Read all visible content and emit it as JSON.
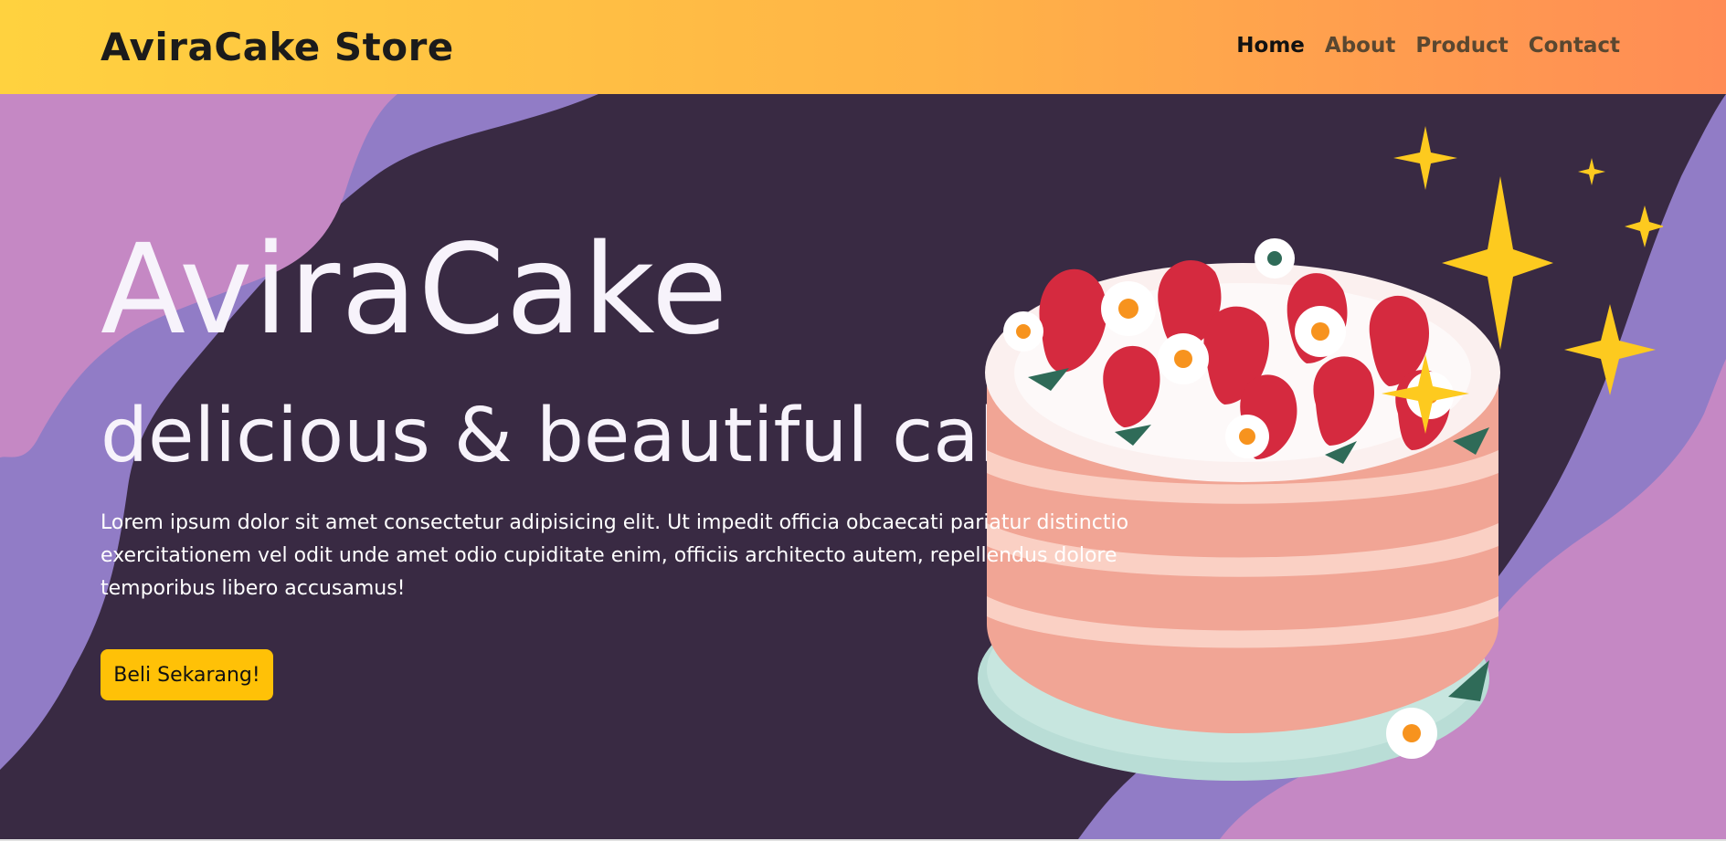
{
  "navbar": {
    "brand": "AviraCake Store",
    "links": [
      {
        "label": "Home",
        "active": true
      },
      {
        "label": "About",
        "active": false
      },
      {
        "label": "Product",
        "active": false
      },
      {
        "label": "Contact",
        "active": false
      }
    ]
  },
  "hero": {
    "title": "AviraCake",
    "subtitle": "delicious & beautiful cakes",
    "description": "Lorem ipsum dolor sit amet consectetur adipisicing elit. Ut impedit officia obcaecati pariatur distinctio exercitationem vel odit unde amet odio cupiditate enim, officiis architecto autem, repellendus dolore temporibus libero accusamus!",
    "cta_label": "Beli Sekarang!"
  },
  "colors": {
    "navbar_gradient_start": "#ffd23f",
    "navbar_gradient_end": "#ff8c55",
    "hero_bg": "#392a43",
    "wave_pink": "#c588c4",
    "wave_purple": "#917cc6",
    "accent_button": "#ffc107",
    "sparkle": "#fdca1f"
  },
  "icons": [
    "cake-illustration",
    "sparkle-icon"
  ]
}
